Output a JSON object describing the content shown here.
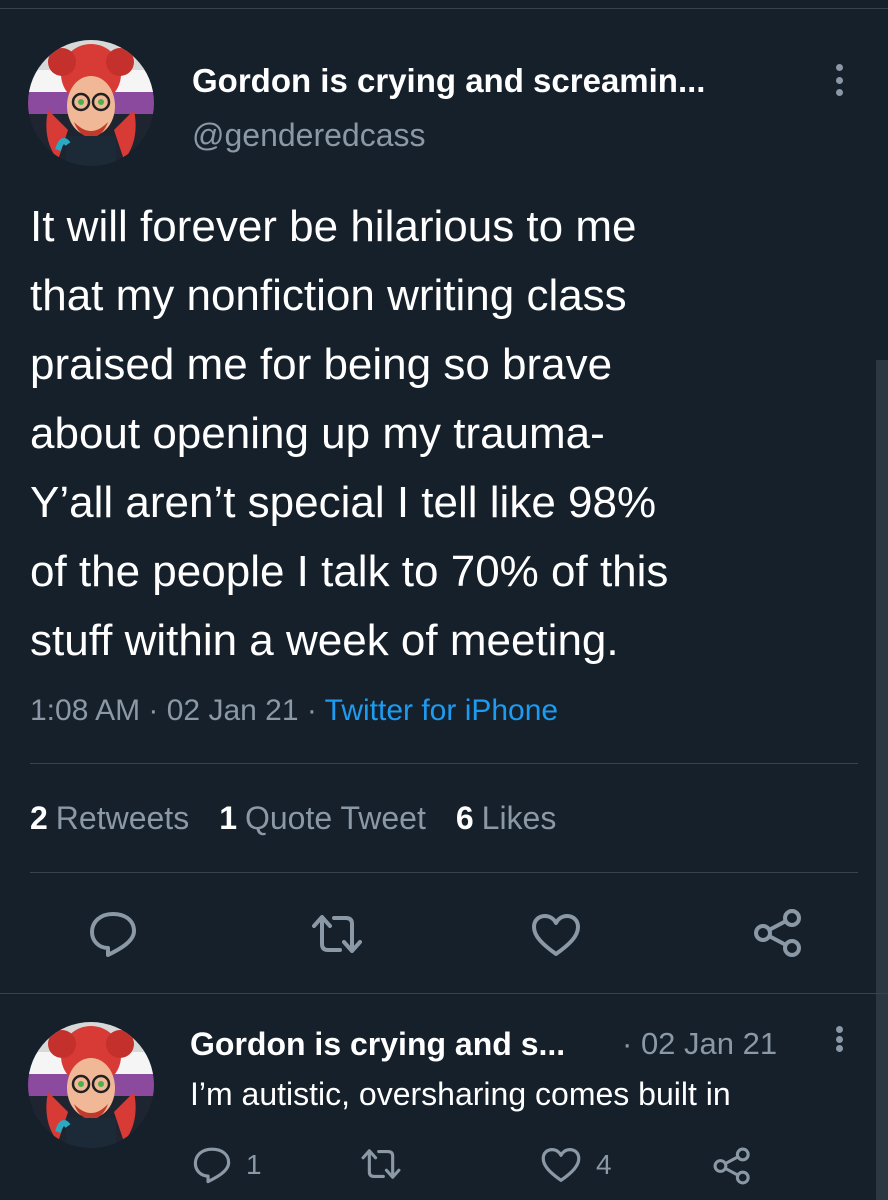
{
  "tweet": {
    "display_name": "Gordon is crying and screamin...",
    "handle": "@genderedcass",
    "text": "It will forever be hilarious to me\nthat my nonfiction writing class\npraised me for being so brave\nabout opening up my trauma-\nY’all aren’t special I tell like 98%\nof the people I talk to 70% of this\nstuff within a week of meeting.",
    "time": "1:08 AM",
    "date": "02 Jan 21",
    "source": "Twitter for iPhone",
    "stats": {
      "retweets_count": "2",
      "retweets_label": "Retweets",
      "quotes_count": "1",
      "quotes_label": "Quote Tweet",
      "likes_count": "6",
      "likes_label": "Likes"
    },
    "actions": {
      "reply_icon": "reply-icon",
      "retweet_icon": "retweet-icon",
      "like_icon": "heart-icon",
      "share_icon": "share-icon"
    }
  },
  "reply": {
    "display_name": "Gordon is crying and s...",
    "date": "02 Jan 21",
    "text": "I’m autistic, oversharing comes built in",
    "reply_count": "1",
    "retweet_count": "",
    "like_count": "4"
  },
  "colors": {
    "background": "#15202b",
    "text_primary": "#ffffff",
    "text_secondary": "#8b98a5",
    "link": "#1d9bf0",
    "divider": "#38444d"
  }
}
